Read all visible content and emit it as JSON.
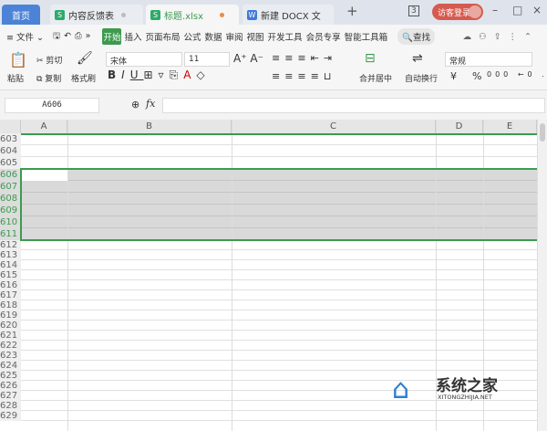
{
  "tabs": [
    {
      "label": "首页"
    },
    {
      "label": "内容反馈表",
      "icon": "S"
    },
    {
      "label": "标题.xlsx",
      "icon": "S"
    },
    {
      "label": "新建 DOCX 文",
      "icon": "W"
    }
  ],
  "titlebar": {
    "badge": "3",
    "login": "访客登录"
  },
  "menu": [
    "≡ 文件 ⌄",
    "开始",
    "插入",
    "页面布局",
    "公式",
    "数据",
    "审阅",
    "视图",
    "开发工具",
    "会员专享",
    "智能工具箱",
    "查找"
  ],
  "ribbon": {
    "paste": "粘贴",
    "cut": "剪切",
    "copy": "复制",
    "format_painter": "格式刷",
    "font": "宋体",
    "size": "11",
    "merge": "合并居中",
    "wrap": "自动换行",
    "number_format": "常规",
    "currency": "¥",
    "percent": "%"
  },
  "formula": {
    "cell_ref": "A606",
    "fx": "fx",
    "value": ""
  },
  "columns": [
    "A",
    "B",
    "C",
    "D",
    "E"
  ],
  "rows": [
    "603",
    "604",
    "605",
    "606",
    "607",
    "608",
    "609",
    "610",
    "611",
    "612",
    "613",
    "614",
    "615",
    "616",
    "617",
    "618",
    "619",
    "620",
    "621",
    "622",
    "623",
    "624",
    "625",
    "626",
    "627",
    "628",
    "629"
  ],
  "selected_rows": [
    "606",
    "607",
    "608",
    "609",
    "610",
    "611"
  ],
  "watermark": {
    "title": "系统之家",
    "url": "XITONGZHIJIA.NET"
  },
  "colors": {
    "accent": "#3d9a4f",
    "home_tab": "#4d83d6",
    "login": "#d65a4f"
  }
}
